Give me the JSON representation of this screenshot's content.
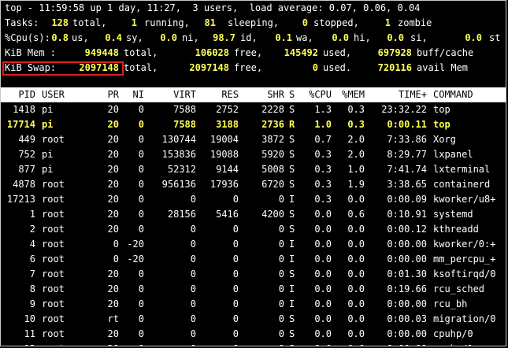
{
  "summary": {
    "top_line": "top - 11:59:58 up 1 day, 11:27,  3 users,  load average: 0.07, 0.06, 0.04",
    "tasks": {
      "label": "Tasks:",
      "total": "128",
      "total_l": "total,",
      "running": "1",
      "running_l": "running,",
      "sleeping": "81",
      "sleeping_l": "sleeping,",
      "stopped": "0",
      "stopped_l": "stopped,",
      "zombie": "1",
      "zombie_l": "zombie"
    },
    "cpu": {
      "label": "%Cpu(s):",
      "us": "0.8",
      "us_l": "us,",
      "sy": "0.4",
      "sy_l": "sy,",
      "ni": "0.0",
      "ni_l": "ni,",
      "id": "98.7",
      "id_l": "id,",
      "wa": "0.1",
      "wa_l": "wa,",
      "hi": "0.0",
      "hi_l": "hi,",
      "si": "0.0",
      "si_l": "si,",
      "st": "0.0",
      "st_l": "st"
    },
    "mem": {
      "label": "KiB Mem :",
      "total": "949448",
      "total_l": "total,",
      "free": "106028",
      "free_l": "free,",
      "used": "145492",
      "used_l": "used,",
      "buff": "697928",
      "buff_l": "buff/cache"
    },
    "swap": {
      "label": "KiB Swap:",
      "total": "2097148",
      "total_l": "total,",
      "free": "2097148",
      "free_l": "free,",
      "used": "0",
      "used_l": "used.",
      "avail": "720116",
      "avail_l": "avail Mem"
    }
  },
  "columns": [
    "PID",
    "USER",
    "PR",
    "NI",
    "VIRT",
    "RES",
    "SHR",
    "S",
    "%CPU",
    "%MEM",
    "TIME+",
    "COMMAND"
  ],
  "processes": [
    {
      "pid": "1418",
      "user": "pi",
      "pr": "20",
      "ni": "0",
      "virt": "7588",
      "res": "2752",
      "shr": "2228",
      "s": "S",
      "cpu": "1.3",
      "mem": "0.3",
      "time": "23:32.22",
      "cmd": "top"
    },
    {
      "pid": "17714",
      "user": "pi",
      "pr": "20",
      "ni": "0",
      "virt": "7588",
      "res": "3188",
      "shr": "2736",
      "s": "R",
      "cpu": "1.0",
      "mem": "0.3",
      "time": "0:00.11",
      "cmd": "top"
    },
    {
      "pid": "449",
      "user": "root",
      "pr": "20",
      "ni": "0",
      "virt": "130744",
      "res": "19004",
      "shr": "3872",
      "s": "S",
      "cpu": "0.7",
      "mem": "2.0",
      "time": "7:33.86",
      "cmd": "Xorg"
    },
    {
      "pid": "752",
      "user": "pi",
      "pr": "20",
      "ni": "0",
      "virt": "153836",
      "res": "19088",
      "shr": "5920",
      "s": "S",
      "cpu": "0.3",
      "mem": "2.0",
      "time": "8:29.77",
      "cmd": "lxpanel"
    },
    {
      "pid": "877",
      "user": "pi",
      "pr": "20",
      "ni": "0",
      "virt": "52312",
      "res": "9144",
      "shr": "5008",
      "s": "S",
      "cpu": "0.3",
      "mem": "1.0",
      "time": "7:41.74",
      "cmd": "lxterminal"
    },
    {
      "pid": "4878",
      "user": "root",
      "pr": "20",
      "ni": "0",
      "virt": "956136",
      "res": "17936",
      "shr": "6720",
      "s": "S",
      "cpu": "0.3",
      "mem": "1.9",
      "time": "3:38.65",
      "cmd": "containerd"
    },
    {
      "pid": "17213",
      "user": "root",
      "pr": "20",
      "ni": "0",
      "virt": "0",
      "res": "0",
      "shr": "0",
      "s": "I",
      "cpu": "0.3",
      "mem": "0.0",
      "time": "0:00.09",
      "cmd": "kworker/u8+"
    },
    {
      "pid": "1",
      "user": "root",
      "pr": "20",
      "ni": "0",
      "virt": "28156",
      "res": "5416",
      "shr": "4200",
      "s": "S",
      "cpu": "0.0",
      "mem": "0.6",
      "time": "0:10.91",
      "cmd": "systemd"
    },
    {
      "pid": "2",
      "user": "root",
      "pr": "20",
      "ni": "0",
      "virt": "0",
      "res": "0",
      "shr": "0",
      "s": "S",
      "cpu": "0.0",
      "mem": "0.0",
      "time": "0:00.12",
      "cmd": "kthreadd"
    },
    {
      "pid": "4",
      "user": "root",
      "pr": "0",
      "ni": "-20",
      "virt": "0",
      "res": "0",
      "shr": "0",
      "s": "I",
      "cpu": "0.0",
      "mem": "0.0",
      "time": "0:00.00",
      "cmd": "kworker/0:+"
    },
    {
      "pid": "6",
      "user": "root",
      "pr": "0",
      "ni": "-20",
      "virt": "0",
      "res": "0",
      "shr": "0",
      "s": "I",
      "cpu": "0.0",
      "mem": "0.0",
      "time": "0:00.00",
      "cmd": "mm_percpu_+"
    },
    {
      "pid": "7",
      "user": "root",
      "pr": "20",
      "ni": "0",
      "virt": "0",
      "res": "0",
      "shr": "0",
      "s": "S",
      "cpu": "0.0",
      "mem": "0.0",
      "time": "0:01.30",
      "cmd": "ksoftirqd/0"
    },
    {
      "pid": "8",
      "user": "root",
      "pr": "20",
      "ni": "0",
      "virt": "0",
      "res": "0",
      "shr": "0",
      "s": "I",
      "cpu": "0.0",
      "mem": "0.0",
      "time": "0:19.66",
      "cmd": "rcu_sched"
    },
    {
      "pid": "9",
      "user": "root",
      "pr": "20",
      "ni": "0",
      "virt": "0",
      "res": "0",
      "shr": "0",
      "s": "I",
      "cpu": "0.0",
      "mem": "0.0",
      "time": "0:00.00",
      "cmd": "rcu_bh"
    },
    {
      "pid": "10",
      "user": "root",
      "pr": "rt",
      "ni": "0",
      "virt": "0",
      "res": "0",
      "shr": "0",
      "s": "S",
      "cpu": "0.0",
      "mem": "0.0",
      "time": "0:00.03",
      "cmd": "migration/0"
    },
    {
      "pid": "11",
      "user": "root",
      "pr": "20",
      "ni": "0",
      "virt": "0",
      "res": "0",
      "shr": "0",
      "s": "S",
      "cpu": "0.0",
      "mem": "0.0",
      "time": "0:00.00",
      "cmd": "cpuhp/0"
    },
    {
      "pid": "12",
      "user": "root",
      "pr": "20",
      "ni": "0",
      "virt": "0",
      "res": "0",
      "shr": "0",
      "s": "S",
      "cpu": "0.0",
      "mem": "0.0",
      "time": "0:00.00",
      "cmd": "cpuhp/1"
    }
  ],
  "highlight_row": 1,
  "annotation": {
    "color": "#e02020",
    "target": "swap-summary-line"
  },
  "colors": {
    "background": "#000000",
    "text": "#ffffff",
    "accent": "#ffff55",
    "header_bg": "#ffffff"
  }
}
